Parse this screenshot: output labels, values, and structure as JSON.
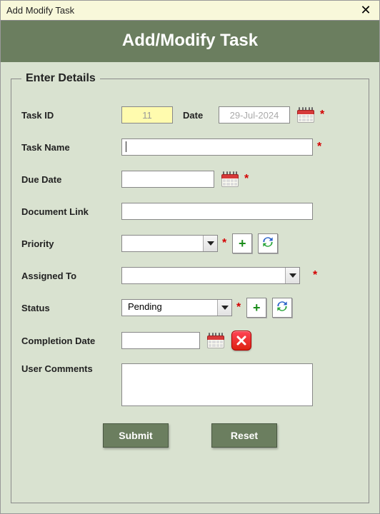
{
  "window": {
    "title": "Add Modify Task"
  },
  "header": {
    "title": "Add/Modify Task"
  },
  "fieldset": {
    "legend": "Enter Details"
  },
  "labels": {
    "task_id": "Task ID",
    "date": "Date",
    "task_name": "Task Name",
    "due_date": "Due Date",
    "document_link": "Document Link",
    "priority": "Priority",
    "assigned_to": "Assigned To",
    "status": "Status",
    "completion_date": "Completion Date",
    "user_comments": "User Comments"
  },
  "values": {
    "task_id": "11",
    "date": "29-Jul-2024",
    "task_name": "",
    "due_date": "",
    "document_link": "",
    "priority": "",
    "assigned_to": "",
    "status": "Pending",
    "completion_date": "",
    "user_comments": ""
  },
  "buttons": {
    "submit": "Submit",
    "reset": "Reset"
  },
  "colors": {
    "accent": "#6b7e5f",
    "panel_bg": "#d9e2d0",
    "required": "#d40000"
  },
  "required_marker": "*"
}
